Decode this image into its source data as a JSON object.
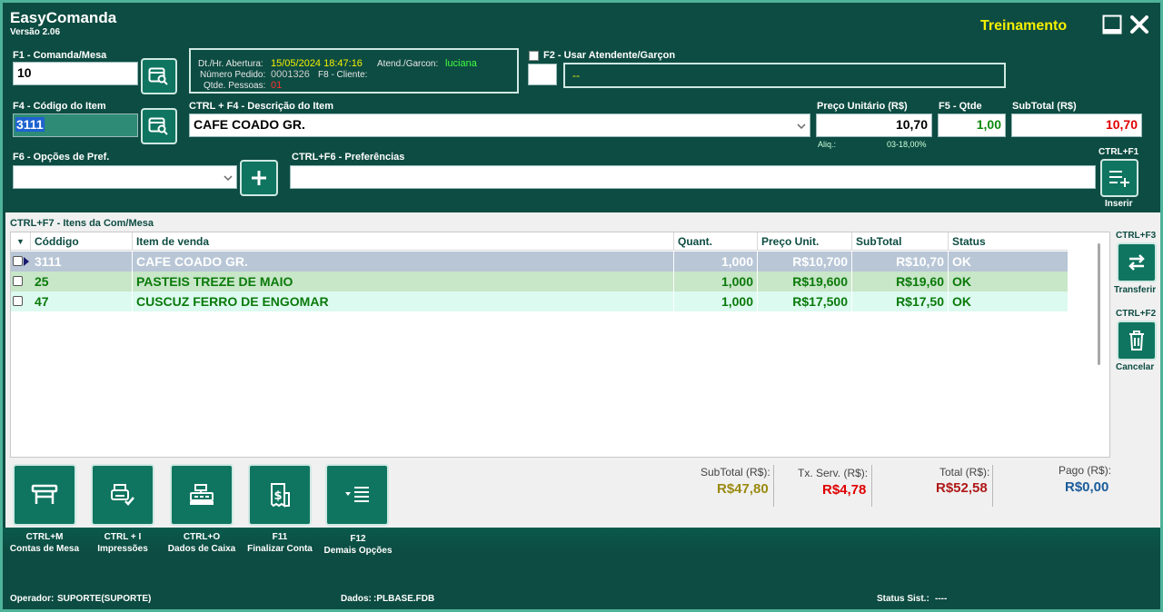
{
  "app": {
    "title": "EasyComanda",
    "version": "Versão 2.06",
    "mode": "Treinamento"
  },
  "comanda": {
    "label": "F1 - Comanda/Mesa",
    "value": "10"
  },
  "info": {
    "abertura_label": "Dt./Hr. Abertura:",
    "abertura_value": "15/05/2024 18:47:16",
    "atendente_label": "Atend./Garcon:",
    "atendente_value": "luciana",
    "pedido_label": "Número Pedido:",
    "pedido_value": "0001326",
    "cliente_label": "F8 - Cliente:",
    "cliente_value": "",
    "pessoas_label": "Qtde. Pessoas:",
    "pessoas_value": "01"
  },
  "atendente": {
    "label": "F2 - Usar Atendente/Garçon",
    "name_value": "--"
  },
  "item": {
    "codigo_label": "F4 - Código do Item",
    "codigo_value": "3111",
    "descricao_label": "CTRL + F4 - Descrição do Item",
    "descricao_value": "CAFE COADO GR.",
    "preco_label": "Preço Unitário (R$)",
    "preco_value": "10,70",
    "qtde_label": "F5 - Qtde",
    "qtde_value": "1,00",
    "subtotal_label": "SubTotal (R$)",
    "subtotal_value": "10,70",
    "aliq_label": "Aliq.:",
    "aliq_value": "03-18,00%"
  },
  "opcoes": {
    "label": "F6 - Opções de Pref.",
    "value": ""
  },
  "preferencias": {
    "label": "CTRL+F6 - Preferências",
    "value": ""
  },
  "inserir": {
    "shortcut": "CTRL+F1",
    "label": "Inserir"
  },
  "items_section": {
    "label": "CTRL+F7 - Itens da Com/Mesa"
  },
  "table": {
    "headers": [
      "Códdigo",
      "Item de venda",
      "Quant.",
      "Preço Unit.",
      "SubTotal",
      "Status"
    ],
    "rows": [
      {
        "codigo": "3111",
        "item": "CAFE COADO GR.",
        "quant": "1,000",
        "preco": "R$10,700",
        "subtotal": "R$10,70",
        "status": "OK"
      },
      {
        "codigo": "25",
        "item": "PASTEIS TREZE DE MAIO",
        "quant": "1,000",
        "preco": "R$19,600",
        "subtotal": "R$19,60",
        "status": "OK"
      },
      {
        "codigo": "47",
        "item": "CUSCUZ FERRO DE ENGOMAR",
        "quant": "1,000",
        "preco": "R$17,500",
        "subtotal": "R$17,50",
        "status": "OK"
      }
    ]
  },
  "side": {
    "transferir_shortcut": "CTRL+F3",
    "transferir_label": "Transferir",
    "cancelar_shortcut": "CTRL+F2",
    "cancelar_label": "Cancelar"
  },
  "bottom_buttons": [
    {
      "shortcut": "CTRL+M",
      "label": "Contas de Mesa"
    },
    {
      "shortcut": "CTRL + I",
      "label": "Impressões"
    },
    {
      "shortcut": "CTRL+O",
      "label": "Dados de Caixa"
    },
    {
      "shortcut": "F11",
      "label": "Finalizar Conta"
    },
    {
      "shortcut": "F12",
      "label": "Demais Opções"
    }
  ],
  "totals": {
    "subtotal_label": "SubTotal (R$):",
    "subtotal_value": "R$47,80",
    "servico_label": "Tx. Serv. (R$):",
    "servico_value": "R$4,78",
    "total_label": "Total (R$):",
    "total_value": "R$52,58",
    "pago_label": "Pago (R$):",
    "pago_value": "R$0,00"
  },
  "status": {
    "operador_label": "Operador:",
    "operador_value": "SUPORTE(SUPORTE)",
    "dados_label": "Dados:",
    "dados_value": ":PLBASE.FDB",
    "sistema_label": "Status Sist.:",
    "sistema_value": "----"
  },
  "colors": {
    "brand": "#0d4c42",
    "accent": "#0f7560",
    "mode": "#f5f000",
    "red": "#e00000",
    "green": "#0a8a0a"
  }
}
